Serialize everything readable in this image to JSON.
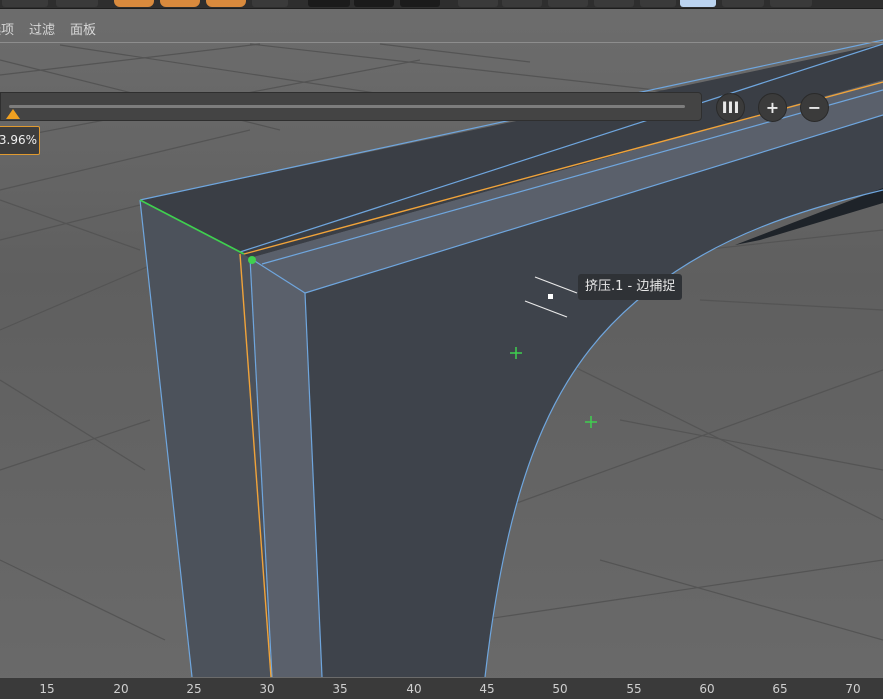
{
  "menu": [
    "选项",
    "过滤",
    "面板"
  ],
  "slider": {
    "value_text": "3.96%",
    "value_fraction": 0.0
  },
  "buttons": {
    "columns": "III",
    "plus": "+",
    "minus": "−"
  },
  "tooltip": "挤压.1 - 边捕捉",
  "ruler": [
    "15",
    "20",
    "25",
    "30",
    "35",
    "40",
    "45",
    "50",
    "55",
    "60",
    "65",
    "70"
  ],
  "colors": {
    "selected_edge": "#f0a33a",
    "snap_edge": "#3fd04f",
    "mesh_outline": "#6fa6de",
    "mesh_face": "#3e434b",
    "slider_accent": "#f0a020"
  }
}
